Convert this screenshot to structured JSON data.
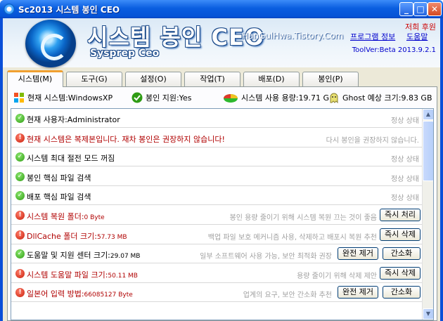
{
  "window": {
    "title": "Sc2013 시스템 봉인 CEO"
  },
  "header": {
    "title": "시스템 봉인 CEO",
    "subtitle": "Sysprep Ceo",
    "site": "HanGulHwa.Tistory.Com",
    "author": "저희 후원",
    "link_info": "프로그램 정보",
    "link_help": "도움말",
    "version": "ToolVer:Beta 2013.9.2.1"
  },
  "tabs": [
    {
      "label": "시스템(M)"
    },
    {
      "label": "도구(G)"
    },
    {
      "label": "설정(O)"
    },
    {
      "label": "작업(T)"
    },
    {
      "label": "배포(D)"
    },
    {
      "label": "봉인(P)"
    }
  ],
  "status": {
    "os": "현재 시스템:WindowsXP",
    "support": "봉인 지원:Yes",
    "usage": "시스템 사용 용량:19.71 G",
    "ghost": "Ghost 예상 크기:9.83 GB"
  },
  "rows": [
    {
      "label": "현재 사용자:Administrator",
      "value": "",
      "desc": "정상 상태",
      "state": "ok"
    },
    {
      "label": "현재 시스템은 복제본입니다. 재차 봉인은 권장하지 않습니다!",
      "value": "",
      "desc": "다시 봉인을 권장하지 않습니다.",
      "state": "warn"
    },
    {
      "label": "시스템 최대 절전 모드 꺼짐",
      "value": "",
      "desc": "정상 상태",
      "state": "ok"
    },
    {
      "label": "봉인 핵심 파일 검색",
      "value": "",
      "desc": "정상 상태",
      "state": "ok"
    },
    {
      "label": "배포 핵심 파일 검색",
      "value": "",
      "desc": "정상 상태",
      "state": "ok"
    },
    {
      "label": "시스템 복원 폴더:",
      "value": "0 Byte",
      "desc": "봉인 용량 줄이기 위해 시스템 복원 끄는 것이 좋음",
      "state": "warn",
      "btn1": "즉시 처리"
    },
    {
      "label": "DllCache 폴더 크기:",
      "value": "57.73 MB",
      "desc": "백업 파일 보호 메커니즘 사용, 삭제하고 배포시 복원 추천",
      "state": "warn",
      "btn1": "즉시 삭제"
    },
    {
      "label": "도움말 및 지원 센터 크기:",
      "value": "29.07 MB",
      "desc": "일부 소프트웨어 사용 가능, 보안 최적화 권장",
      "state": "ok",
      "btn1": "완전 제거",
      "btn2": "간소화"
    },
    {
      "label": "시스템 도움말 파일 크기:",
      "value": "50.11 MB",
      "desc": "용량 줄이기 위해 삭제 제안",
      "state": "warn",
      "btn1": "즉시 삭제"
    },
    {
      "label": "일본어 입력 방법:",
      "value": "66085127 Byte",
      "desc": "업계의 요구, 보안 간소화 추천",
      "state": "warn",
      "btn1": "완전 제거",
      "btn2": "간소화"
    }
  ]
}
